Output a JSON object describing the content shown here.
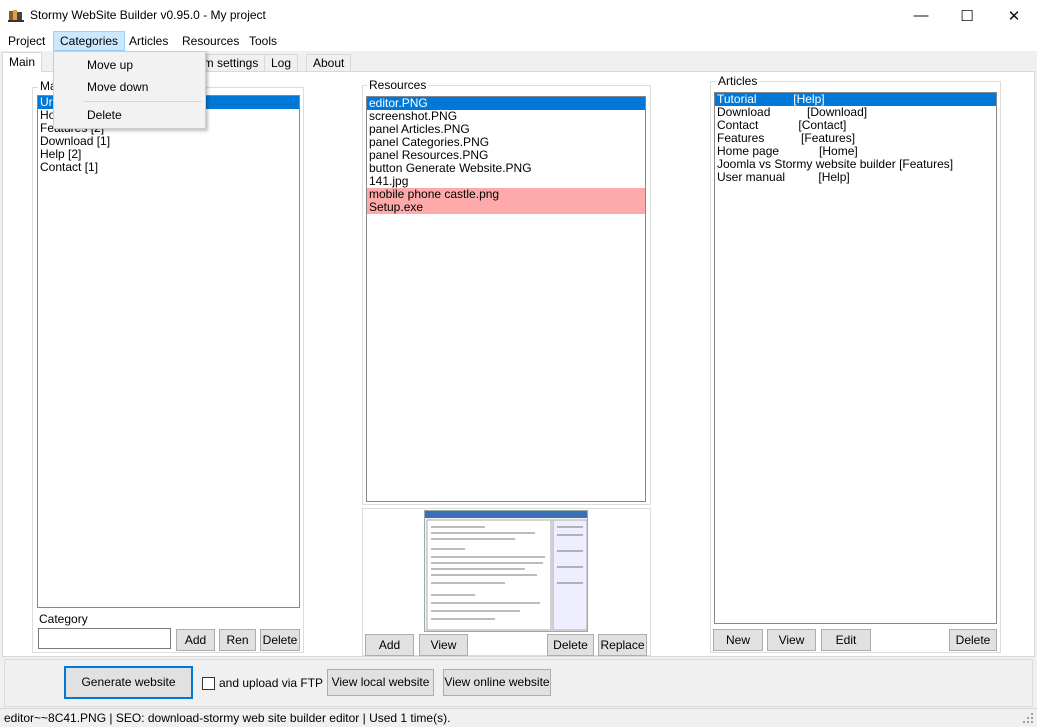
{
  "window": {
    "title": "Stormy WebSite Builder  v0.95.0 - My project",
    "min_glyph": "—",
    "max_glyph": "☐",
    "close_glyph": "✕"
  },
  "menu": {
    "project": "Project",
    "categories": "Categories",
    "articles": "Articles",
    "resources": "Resources",
    "tools": "Tools"
  },
  "dropdown": {
    "move_up": "Move up",
    "move_down": "Move down",
    "delete": "Delete"
  },
  "tabs": {
    "main": "Main",
    "program_settings": "am settings",
    "log": "Log",
    "about": "About"
  },
  "categories_panel": {
    "label": "Ma",
    "items": [
      {
        "text": "Ur",
        "selected": true
      },
      {
        "text": "Ho",
        "selected": false
      },
      {
        "text": "Features [2]",
        "selected": false
      },
      {
        "text": "Download [1]",
        "selected": false
      },
      {
        "text": "Help [2]",
        "selected": false
      },
      {
        "text": "Contact [1]",
        "selected": false
      }
    ],
    "category_label": "Category",
    "category_value": "",
    "add": "Add",
    "rename": "Ren",
    "delete": "Delete"
  },
  "resources_panel": {
    "label": "Resources",
    "items": [
      {
        "text": "editor.PNG",
        "state": "selected"
      },
      {
        "text": "screenshot.PNG",
        "state": "normal"
      },
      {
        "text": "panel Articles.PNG",
        "state": "normal"
      },
      {
        "text": "panel Categories.PNG",
        "state": "normal"
      },
      {
        "text": "panel Resources.PNG",
        "state": "normal"
      },
      {
        "text": "button Generate Website.PNG",
        "state": "normal"
      },
      {
        "text": "141.jpg",
        "state": "normal"
      },
      {
        "text": "mobile phone castle.png",
        "state": "missing"
      },
      {
        "text": "Setup.exe",
        "state": "missing"
      }
    ],
    "add": "Add",
    "view": "View",
    "delete": "Delete",
    "replace": "Replace"
  },
  "articles_panel": {
    "label": "Articles",
    "items": [
      {
        "text": "Tutorial           [Help]",
        "selected": true
      },
      {
        "text": "Download           [Download]",
        "selected": false
      },
      {
        "text": "Contact            [Contact]",
        "selected": false
      },
      {
        "text": "Features           [Features]",
        "selected": false
      },
      {
        "text": "Home page            [Home]",
        "selected": false
      },
      {
        "text": "Joomla vs Stormy website builder [Features]",
        "selected": false
      },
      {
        "text": "User manual          [Help]",
        "selected": false
      }
    ],
    "new": "New",
    "view": "View",
    "edit": "Edit",
    "delete": "Delete"
  },
  "bottom": {
    "generate": "Generate website",
    "ftp_label": "and upload via FTP",
    "ftp_checked": false,
    "view_local": "View local website",
    "view_online": "View online website"
  },
  "status": {
    "text": "editor~~8C41.PNG | SEO: download-stormy web site builder editor | Used 1 time(s)."
  },
  "colors": {
    "selection": "#0078d7",
    "missing": "#ffaaaa",
    "menu_highlight": "#cce8ff"
  },
  "icons": {
    "app": "books-icon",
    "checkbox": "checkbox-icon",
    "grip": "resize-grip-icon"
  }
}
